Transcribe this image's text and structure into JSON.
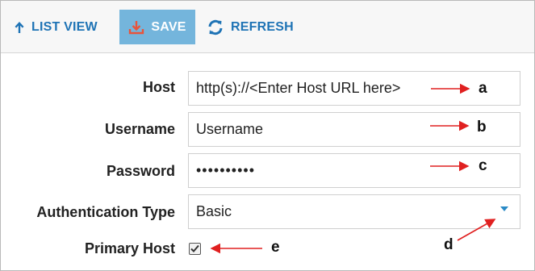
{
  "toolbar": {
    "list_view_label": "LIST VIEW",
    "save_label": "SAVE",
    "refresh_label": "REFRESH"
  },
  "form": {
    "host": {
      "label": "Host",
      "value": "http(s)://<Enter Host URL here>"
    },
    "username": {
      "label": "Username",
      "value": "Username"
    },
    "password": {
      "label": "Password",
      "value": "••••••••••"
    },
    "auth_type": {
      "label": "Authentication Type",
      "value": "Basic"
    },
    "primary_host": {
      "label": "Primary Host",
      "checked": true
    }
  },
  "annotations": {
    "a": "a",
    "b": "b",
    "c": "c",
    "d": "d",
    "e": "e"
  },
  "colors": {
    "accent": "#1e73b5",
    "save_bg": "#74b5dc",
    "arrow": "#e02020",
    "caret": "#2a8ac6"
  }
}
